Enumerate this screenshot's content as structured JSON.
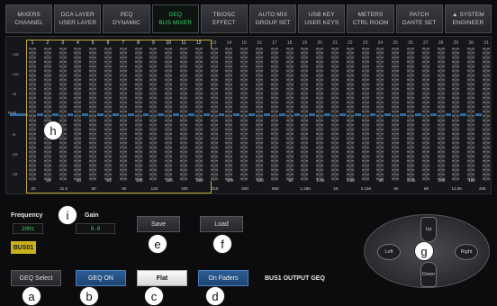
{
  "tabs": [
    {
      "line1": "MIXERS",
      "line2": "CHANNEL",
      "active": false
    },
    {
      "line1": "DCA LAYER",
      "line2": "USER LAYER",
      "active": false
    },
    {
      "line1": "PEQ",
      "line2": "DYNAMIC",
      "active": false
    },
    {
      "line1": "GEQ",
      "line2": "BUS MIXER",
      "active": true
    },
    {
      "line1": "TB/OSC",
      "line2": "EFFECT",
      "active": false
    },
    {
      "line1": "AUTO MIX",
      "line2": "GROUP SET",
      "active": false
    },
    {
      "line1": "USB KEY",
      "line2": "USER KEYS",
      "active": false
    },
    {
      "line1": "METERS",
      "line2": "CTRL ROOM",
      "active": false
    },
    {
      "line1": "PATCH",
      "line2": "DANTE SET",
      "active": false
    },
    {
      "line1": "▲ SYSTEM",
      "line2": "ENGINEER",
      "active": false
    }
  ],
  "geq": {
    "channels": [
      "1",
      "2",
      "3",
      "4",
      "5",
      "6",
      "7",
      "8",
      "9",
      "10",
      "11",
      "12",
      "13",
      "14",
      "15",
      "16",
      "17",
      "18",
      "19",
      "20",
      "21",
      "22",
      "23",
      "24",
      "25",
      "26",
      "27",
      "28",
      "29",
      "30",
      "31"
    ],
    "scale": [
      "+15",
      "+10",
      "+5",
      "Rel0",
      "-5",
      "-10",
      "-15"
    ],
    "freq_row_a": [
      "25",
      "40",
      "63",
      "100",
      "160",
      "250",
      "400",
      "630",
      "1K",
      "1.6K",
      "2.5K",
      "4K",
      "6.3K",
      "10K",
      "16K"
    ],
    "freq_row_b": [
      "20",
      "31.5",
      "50",
      "80",
      "125",
      "200",
      "315",
      "500",
      "800",
      "1.25K",
      "2K",
      "3.15K",
      "5K",
      "8K",
      "12.5K",
      "20K"
    ]
  },
  "controls": {
    "frequency_label": "Frequency",
    "frequency_value": "20Hz",
    "gain_label": "Gain",
    "gain_value": "0.0",
    "bus_tag": "BUS01",
    "save_label": "Save",
    "load_label": "Load",
    "geq_select_label": "GEQ Select",
    "geq_on_label": "GEQ ON",
    "flat_label": "Flat",
    "on_faders_label": "On Faders",
    "status_text": "BUS1 OUTPUT GEQ"
  },
  "dpad": {
    "up": "Up",
    "down": "Down",
    "left": "Left",
    "right": "Right"
  },
  "callouts": {
    "a": "a",
    "b": "b",
    "c": "c",
    "d": "d",
    "e": "e",
    "f": "f",
    "g": "g",
    "h": "h",
    "i": "i"
  }
}
